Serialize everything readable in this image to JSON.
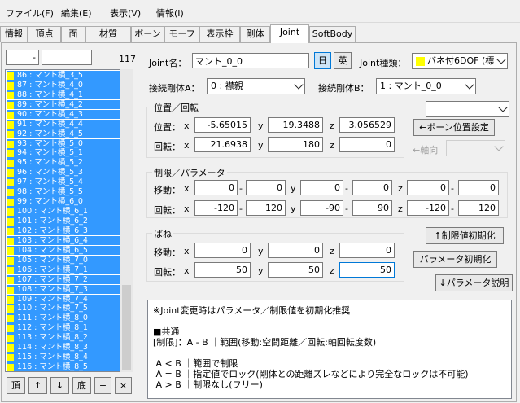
{
  "menu": [
    "ファイル(F)",
    "編集(E)",
    "表示(V)",
    "情報(I)"
  ],
  "tabs": [
    "情報",
    "頂点",
    "面",
    "材質",
    "ボーン",
    "モーフ",
    "表示枠",
    "剛体",
    "Joint",
    "SoftBody"
  ],
  "left": {
    "search_value": "-",
    "filter_value": "",
    "count": "117",
    "rows": [
      "86 : マント横_3_5",
      "87 : マント横_4_0",
      "88 : マント横_4_1",
      "89 : マント横_4_2",
      "90 : マント横_4_3",
      "91 : マント横_4_4",
      "92 : マント横_4_5",
      "93 : マント横_5_0",
      "94 : マント横_5_1",
      "95 : マント横_5_2",
      "96 : マント横_5_3",
      "97 : マント横_5_4",
      "98 : マント横_5_5",
      "99 : マント横_6_0",
      "100 : マント横_6_1",
      "101 : マント横_6_2",
      "102 : マント横_6_3",
      "103 : マント横_6_4",
      "104 : マント横_6_5",
      "105 : マント横_7_0",
      "106 : マント横_7_1",
      "107 : マント横_7_2",
      "108 : マント横_7_3",
      "109 : マント横_7_4",
      "110 : マント横_7_5",
      "111 : マント横_8_0",
      "112 : マント横_8_1",
      "113 : マント横_8_2",
      "114 : マント横_8_3",
      "115 : マント横_8_4",
      "116 : マント横_8_5"
    ],
    "buttons": [
      "頂",
      "↑",
      "↓",
      "底",
      "+",
      "×"
    ]
  },
  "joint": {
    "name_label": "Joint名：",
    "name_value": "マント_0_0",
    "lang_ja": "日",
    "lang_en": "英",
    "type_label": "Joint種類：",
    "type_value": "バネ付6DOF (標",
    "body_a_label": "接続剛体A：",
    "body_a_value": "0 : 襟親",
    "body_b_label": "接続剛体B：",
    "body_b_value": "1 : マント_0_0",
    "pos_rot_title": "位置／回転",
    "pos_label": "位置：",
    "rot_label": "回転：",
    "axis_x": "x",
    "axis_y": "y",
    "axis_z": "z",
    "pos": [
      "-5.65015",
      "19.3488",
      "3.056529"
    ],
    "rot": [
      "21.6938",
      "180",
      "0"
    ],
    "bone_pos_button": "←ボーン位置設定",
    "axis_dir_label": "←軸向",
    "limit_title": "制限／パラメータ",
    "move_label": "移動：",
    "limit_rot_label": "回転：",
    "dash": "-",
    "move_limits": [
      "0",
      "0",
      "0",
      "0",
      "0",
      "0"
    ],
    "rot_limits": [
      "-120",
      "120",
      "-90",
      "90",
      "-120",
      "120"
    ],
    "spring_title": "ばね",
    "spring_move_label": "移動：",
    "spring_rot_label": "回転：",
    "spring_move": [
      "0",
      "0",
      "0"
    ],
    "spring_rot": [
      "50",
      "50",
      "50"
    ],
    "limit_init_button": "↑制限値初期化",
    "param_init_button": "パラメータ初期化",
    "param_desc_button": "↓パラメータ説明"
  },
  "desc": [
    "※Joint変更時はパラメータ／制限値を初期化推奨",
    "",
    "■共通",
    "[制限]：A - B ｜範囲(移動:空間距離／回転:軸回転度数)",
    "",
    " A < B ｜範囲で制限",
    " A = B ｜指定値でロック(剛体との距離ズレなどにより完全なロックは不可能)",
    " A > B ｜制限なし(フリー)"
  ],
  "colors": {
    "selection": "#3399ff",
    "swatch": "#ffff00"
  }
}
